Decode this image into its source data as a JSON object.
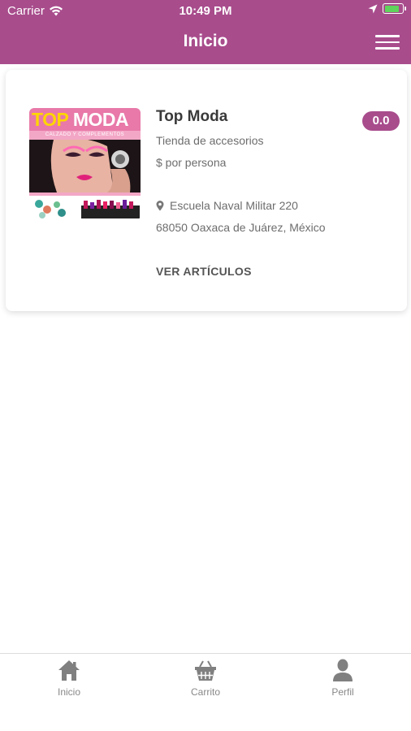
{
  "status_bar": {
    "carrier": "Carrier",
    "time": "10:49 PM"
  },
  "nav": {
    "title": "Inicio",
    "menu_icon": "hamburger-menu-icon"
  },
  "colors": {
    "brand": "#a84c8c",
    "battery": "#5fd35b"
  },
  "store": {
    "image_banner_word1": "TOP",
    "image_banner_word2": "MODA",
    "image_tagline": "CALZADO Y COMPLEMENTOS",
    "name": "Top Moda",
    "rating": "0.0",
    "category": "Tienda de accesorios",
    "price": "$ por persona",
    "address_line1": "Escuela Naval Militar 220",
    "address_line2": "68050 Oaxaca de Juárez, México",
    "cta": "VER ARTÍCULOS"
  },
  "tabs": [
    {
      "label": "Inicio",
      "icon": "home-icon"
    },
    {
      "label": "Carrito",
      "icon": "basket-icon"
    },
    {
      "label": "Perfil",
      "icon": "user-icon"
    }
  ]
}
